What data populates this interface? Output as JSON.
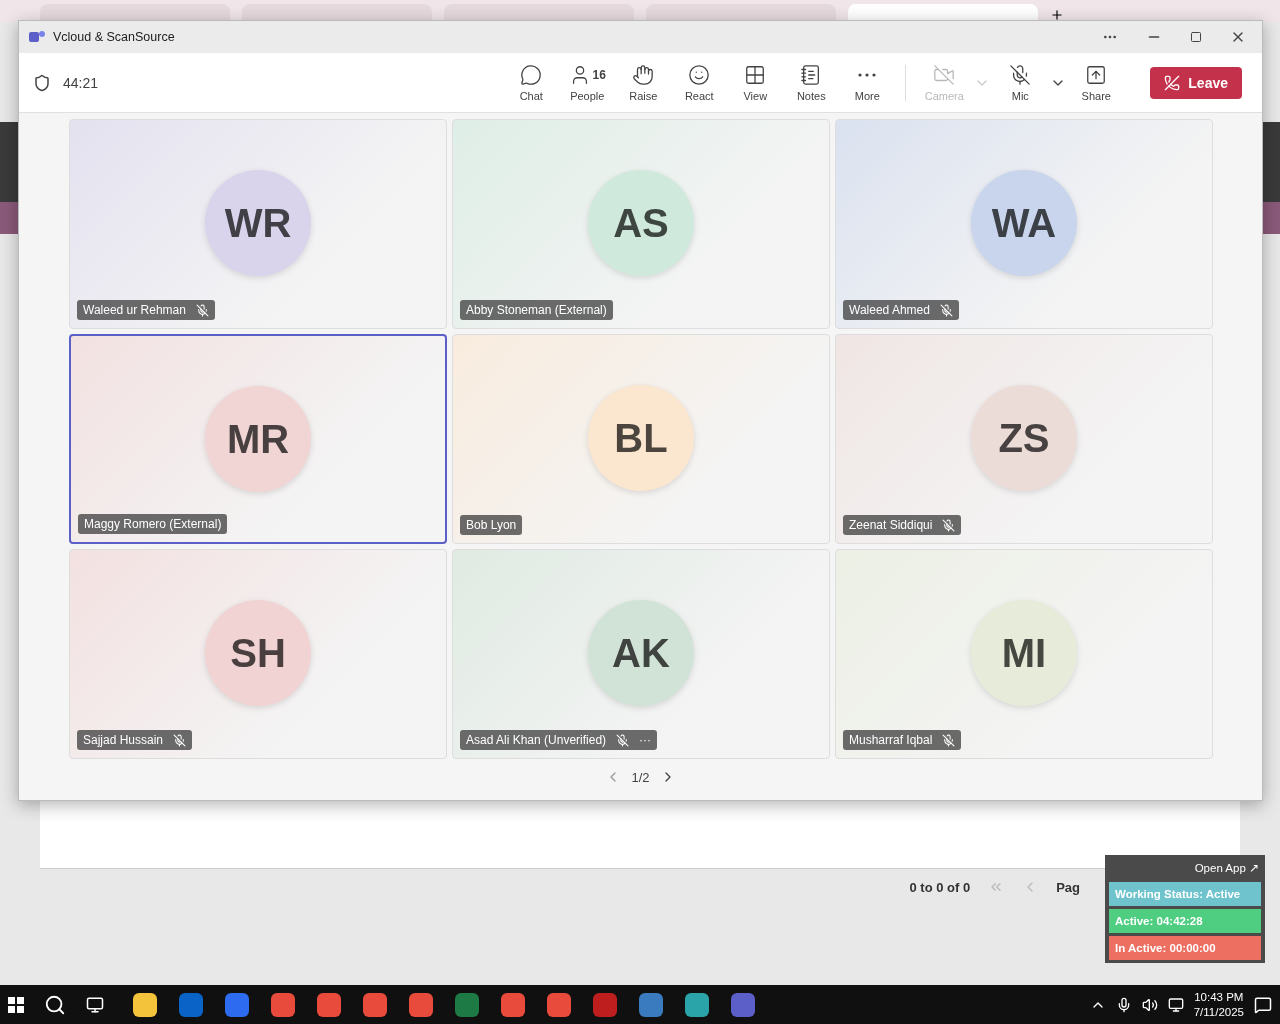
{
  "browser_tabs": [
    {
      "selected": false
    },
    {
      "selected": false
    },
    {
      "selected": false
    },
    {
      "selected": false
    },
    {
      "selected": true
    }
  ],
  "background_page": {
    "range": "0 to 0 of 0",
    "page_label": "Pag"
  },
  "window": {
    "title": "Vcloud & ScanSource"
  },
  "call": {
    "timer": "44:21"
  },
  "toolbar": [
    {
      "label": "Chat",
      "disabled": false
    },
    {
      "label": "People",
      "count": "16",
      "disabled": false
    },
    {
      "label": "Raise",
      "disabled": false
    },
    {
      "label": "React",
      "disabled": false
    },
    {
      "label": "View",
      "disabled": false
    },
    {
      "label": "Notes",
      "disabled": false
    },
    {
      "label": "More",
      "disabled": false
    },
    {
      "label": "Camera",
      "disabled": true,
      "dropdown": true
    },
    {
      "label": "Mic",
      "disabled": false,
      "dropdown": true
    },
    {
      "label": "Share",
      "disabled": false
    }
  ],
  "leave_button": "Leave",
  "participants": [
    {
      "initials": "WR",
      "name": "Waleed ur Rehman",
      "muted": true,
      "selected": false,
      "color": "#d9d4ec"
    },
    {
      "initials": "AS",
      "name": "Abby Stoneman (External)",
      "muted": false,
      "selected": false,
      "color": "#cfe9dc"
    },
    {
      "initials": "WA",
      "name": "Waleed Ahmed",
      "muted": true,
      "selected": false,
      "color": "#c9d5ec"
    },
    {
      "initials": "MR",
      "name": "Maggy Romero (External)",
      "muted": false,
      "selected": true,
      "color": "#f1d4d4"
    },
    {
      "initials": "BL",
      "name": "Bob Lyon",
      "muted": false,
      "selected": false,
      "color": "#fbe6cf"
    },
    {
      "initials": "ZS",
      "name": "Zeenat Siddiqui",
      "muted": true,
      "selected": false,
      "color": "#ecdcd8"
    },
    {
      "initials": "SH",
      "name": "Sajjad Hussain",
      "muted": true,
      "selected": false,
      "color": "#f2d3d3"
    },
    {
      "initials": "AK",
      "name": "Asad Ali Khan (Unverified)",
      "muted": true,
      "selected": false,
      "color": "#d1e3d6",
      "menu": "···"
    },
    {
      "initials": "MI",
      "name": "Musharraf Iqbal",
      "muted": true,
      "selected": false,
      "color": "#e6ecd9"
    }
  ],
  "pager": "1/2",
  "status_widget": {
    "open_app": "Open App ↗",
    "rows": [
      {
        "text": "Working Status: Active",
        "color": "#6fc3cc"
      },
      {
        "text": "Active: 04:42:28",
        "color": "#4fce82"
      },
      {
        "text": "In Active: 00:00:00",
        "color": "#ec6f62"
      }
    ]
  },
  "taskbar": {
    "time": "10:43 PM",
    "date": "7/11/2025"
  }
}
